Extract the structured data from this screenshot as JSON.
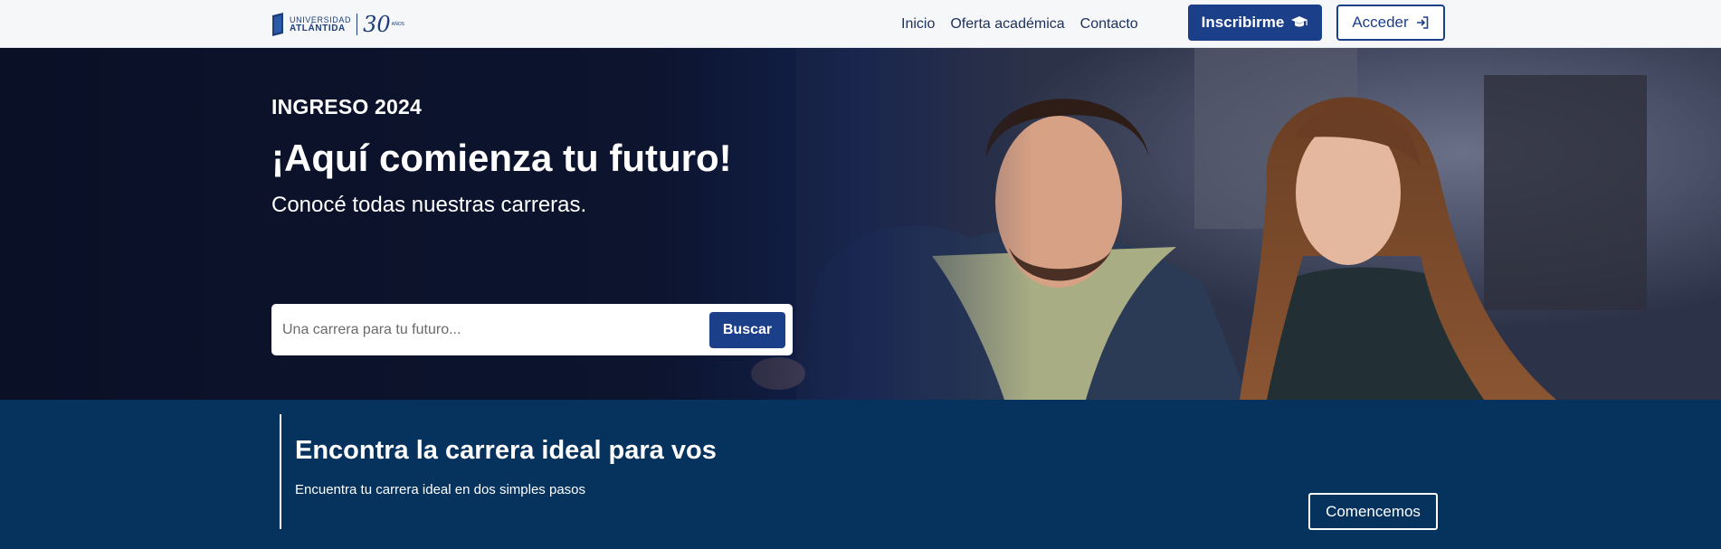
{
  "navbar": {
    "logo": {
      "line1": "UNIVERSIDAD",
      "line2": "ATLÁNTIDA",
      "anniversary": "30",
      "anniversary_suffix": "AÑOS"
    },
    "links": [
      {
        "label": "Inicio"
      },
      {
        "label": "Oferta académica"
      },
      {
        "label": "Contacto"
      }
    ],
    "register_button": {
      "label": "Inscribirme",
      "icon": "graduation-cap-icon"
    },
    "login_button": {
      "label": "Acceder",
      "icon": "sign-in-icon"
    }
  },
  "hero": {
    "eyebrow": "INGRESO 2024",
    "title": "¡Aquí comienza tu futuro!",
    "subtitle": "Conocé todas nuestras carreras.",
    "search": {
      "placeholder": "Una carrera para tu futuro...",
      "value": "",
      "button_label": "Buscar"
    }
  },
  "finder": {
    "title": "Encontra la carrera ideal para vos",
    "text": "Encuentra tu carrera ideal en dos simples pasos",
    "button_label": "Comencemos"
  },
  "colors": {
    "primary": "#1c3f8a",
    "band": "#06325e",
    "nav_bg": "#f6f7f9",
    "nav_text": "#1d2f5c"
  }
}
